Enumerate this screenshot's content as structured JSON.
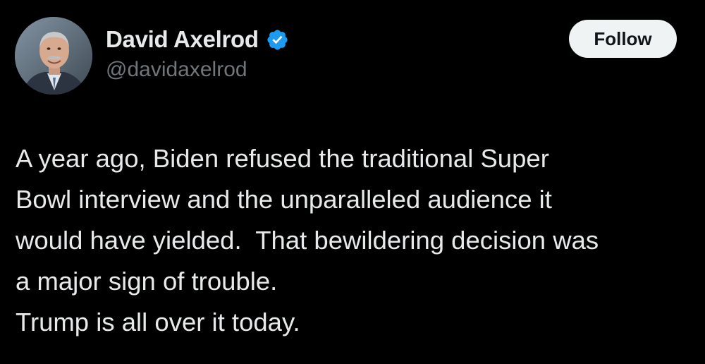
{
  "author": {
    "display_name": "David Axelrod",
    "handle": "@davidaxelrod",
    "verified": true,
    "verified_icon": "verified-badge-icon",
    "avatar_icon": "profile-photo"
  },
  "actions": {
    "follow_label": "Follow"
  },
  "tweet": {
    "lines": [
      "A year ago, Biden refused the traditional Super",
      "Bowl interview and the unparalleled audience it",
      "would have yielded.  That bewildering decision was",
      "a major sign of trouble.",
      "Trump is all over it today."
    ]
  },
  "colors": {
    "background": "#000000",
    "text_primary": "#e7e9ea",
    "text_secondary": "#71767b",
    "verified_blue": "#1d9bf0",
    "follow_button_bg": "#eff3f4",
    "follow_button_text": "#0f1419"
  }
}
